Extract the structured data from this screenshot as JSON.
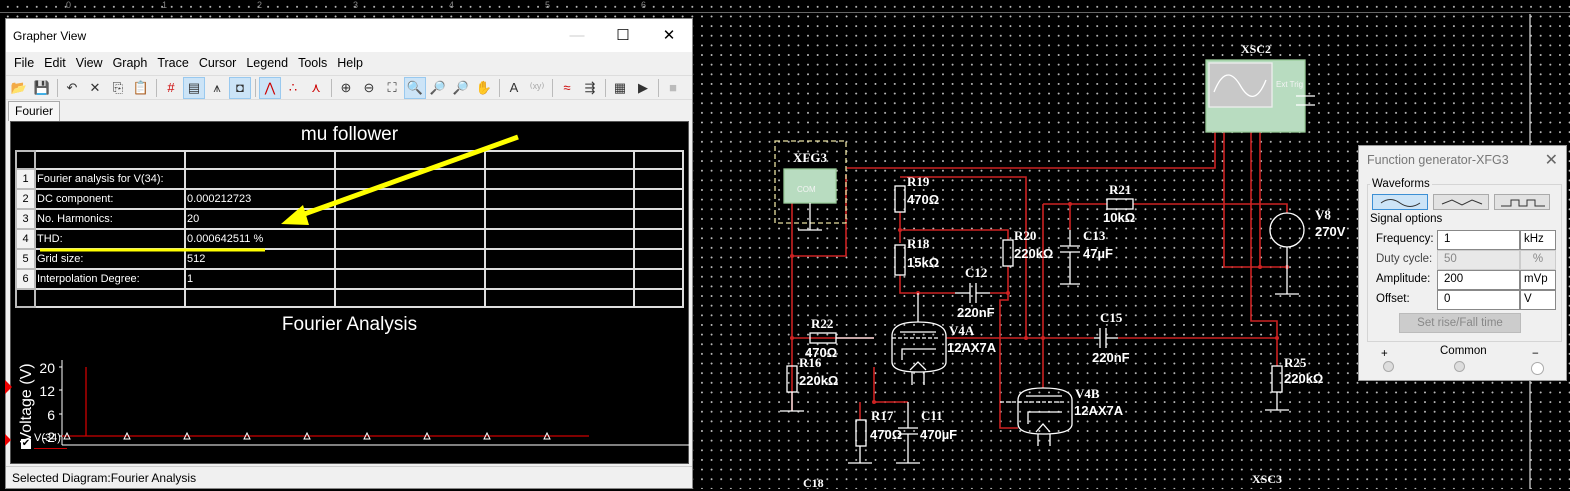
{
  "ruler": {
    "labels": [
      "0",
      "1",
      "2",
      "3",
      "4",
      "5",
      "6"
    ]
  },
  "grapher": {
    "title": "Grapher View",
    "window_controls": {
      "minimize": "—",
      "maximize": "☐",
      "close": "✕"
    },
    "menu": [
      "File",
      "Edit",
      "View",
      "Graph",
      "Trace",
      "Cursor",
      "Legend",
      "Tools",
      "Help"
    ],
    "toolbar": [
      {
        "name": "open-icon",
        "glyph": "📂"
      },
      {
        "name": "save-icon",
        "glyph": "💾"
      },
      {
        "sep": true
      },
      {
        "name": "undo-icon",
        "glyph": "↶"
      },
      {
        "name": "cut-icon",
        "glyph": "✕"
      },
      {
        "name": "copy-icon",
        "glyph": "⎘"
      },
      {
        "name": "paste-icon",
        "glyph": "📋"
      },
      {
        "sep": true
      },
      {
        "name": "grid-icon",
        "glyph": "#",
        "color": "#c00"
      },
      {
        "name": "legend-icon",
        "glyph": "▤",
        "on": true
      },
      {
        "name": "cursors-icon",
        "glyph": "⩚"
      },
      {
        "name": "reverse-colors-icon",
        "glyph": "◘",
        "on": true
      },
      {
        "sep": true
      },
      {
        "name": "show-lines-icon",
        "glyph": "⋀",
        "color": "#c00",
        "on": true
      },
      {
        "name": "show-points-icon",
        "glyph": "∴",
        "color": "#c00"
      },
      {
        "name": "lines-and-points-icon",
        "glyph": "⋏",
        "color": "#c00"
      },
      {
        "sep": true
      },
      {
        "name": "zoom-in-icon",
        "glyph": "⊕"
      },
      {
        "name": "zoom-out-icon",
        "glyph": "⊖"
      },
      {
        "name": "zoom-area-icon",
        "glyph": "⛶"
      },
      {
        "name": "zoom-fit-icon",
        "glyph": "🔍",
        "on": true
      },
      {
        "name": "zoom-x-icon",
        "glyph": "🔎"
      },
      {
        "name": "zoom-y-icon",
        "glyph": "🔎"
      },
      {
        "name": "pan-icon",
        "glyph": "✋"
      },
      {
        "sep": true
      },
      {
        "name": "add-text-icon",
        "glyph": "A"
      },
      {
        "name": "label-icon",
        "glyph": "⁽ˣʸ⁾",
        "color": "#aaa"
      },
      {
        "sep": true
      },
      {
        "name": "overlay-traces-icon",
        "glyph": "≈",
        "color": "#c00"
      },
      {
        "name": "export-icon",
        "glyph": "⇶"
      },
      {
        "sep": true
      },
      {
        "name": "export-excel-icon",
        "glyph": "▦"
      },
      {
        "name": "export-labview-icon",
        "glyph": "▶"
      },
      {
        "sep": true
      },
      {
        "name": "stop-icon",
        "glyph": "■",
        "color": "#bbb"
      }
    ],
    "tab": "Fourier",
    "table_title": "mu follower",
    "rows": [
      {
        "n": "1",
        "label": "Fourier analysis for V(34):",
        "value": ""
      },
      {
        "n": "2",
        "label": "DC component:",
        "value": "0.000212723"
      },
      {
        "n": "3",
        "label": "No. Harmonics:",
        "value": "20"
      },
      {
        "n": "4",
        "label": "THD:",
        "value": "0.000642511 %"
      },
      {
        "n": "5",
        "label": "Grid size:",
        "value": "512"
      },
      {
        "n": "6",
        "label": "Interpolation Degree:",
        "value": "1"
      }
    ],
    "annotation_color": "#ffff00",
    "status": "Selected Diagram:Fourier Analysis"
  },
  "chart_data": {
    "type": "bar",
    "title": "Fourier Analysis",
    "ylabel": "Voltage (V)",
    "xlabel": "",
    "yticks": [
      20,
      12,
      6,
      -2
    ],
    "ylim": [
      -4,
      22
    ],
    "grid": false,
    "series": [
      {
        "name": "V(34)",
        "color": "#cc0000",
        "values": [
          20,
          -2,
          -2,
          -2,
          -2,
          -2,
          -2,
          -2,
          -2,
          -2
        ]
      }
    ],
    "marker_count": 9,
    "legend_placement": "bottom-left"
  },
  "schematic": {
    "wire_color": "#cc2222",
    "labels": {
      "xfg3": "XFG3",
      "xsc2": "XSC2",
      "xsc3": "XSC3",
      "c18": "C18",
      "r19": "R19",
      "r19v": "470Ω",
      "r18": "R18",
      "r18v": "15kΩ",
      "r20": "R20",
      "r20v": "220kΩ",
      "c12": "C12",
      "c12v": "220nF",
      "c13": "C13",
      "c13v": "47µF",
      "r21": "R21",
      "r21v": "10kΩ",
      "r22": "R22",
      "r22v": "470Ω",
      "r16": "R16",
      "r16v": "220kΩ",
      "v4a": "V4A",
      "v4av": "12AX7A",
      "c15": "C15",
      "c15v": "220nF",
      "v4b": "V4B",
      "v4bv": "12AX7A",
      "r17": "R17",
      "r17v": "470Ω",
      "c11": "C11",
      "c11v": "470µF",
      "r25": "R25",
      "r25v": "220kΩ",
      "v8": "V8",
      "v8v": "270V",
      "ext_trig": "Ext Trig",
      "com": "COM"
    }
  },
  "function_generator": {
    "title": "Function generator-XFG3",
    "waveforms_label": "Waveforms",
    "waveforms": [
      {
        "name": "sine",
        "selected": true
      },
      {
        "name": "triangle",
        "selected": false
      },
      {
        "name": "square",
        "selected": false
      }
    ],
    "signal_options_label": "Signal options",
    "fields": [
      {
        "label": "Frequency:",
        "value": "1",
        "unit": "kHz",
        "enabled": true
      },
      {
        "label": "Duty cycle:",
        "value": "50",
        "unit": "%",
        "enabled": false
      },
      {
        "label": "Amplitude:",
        "value": "200",
        "unit": "mVp",
        "enabled": true
      },
      {
        "label": "Offset:",
        "value": "0",
        "unit": "V",
        "enabled": true
      }
    ],
    "rise_fall_button": "Set rise/Fall time",
    "terminals": {
      "plus": "+",
      "common": "Common",
      "minus": "−"
    }
  }
}
